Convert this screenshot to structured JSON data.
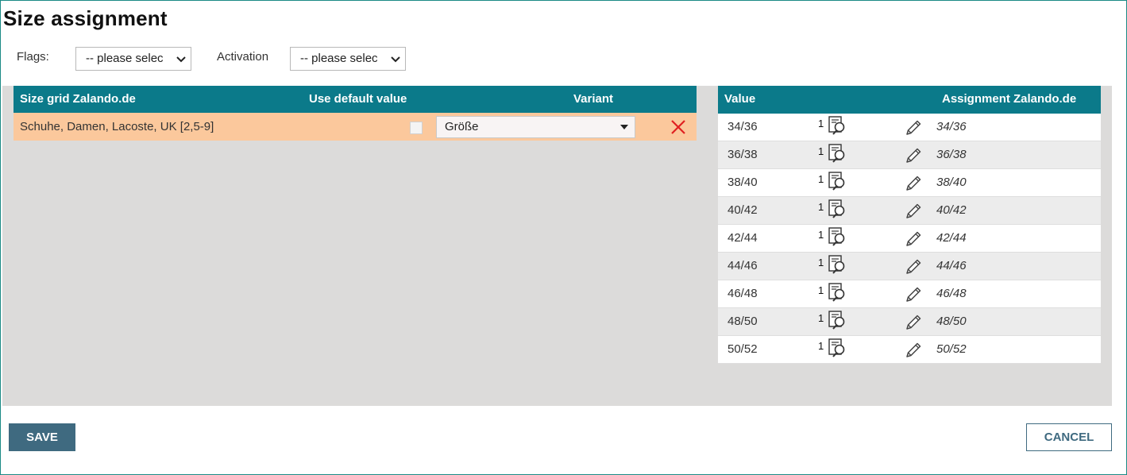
{
  "page": {
    "title": "Size assignment"
  },
  "filters": {
    "flags_label": "Flags:",
    "flags_value": "-- please selec",
    "activation_label": "Activation",
    "activation_value": "-- please selec"
  },
  "grid": {
    "headers": {
      "size_grid": "Size grid Zalando.de",
      "use_default": "Use default value",
      "variant": "Variant"
    },
    "row": {
      "name": "Schuhe, Damen, Lacoste, UK [2,5-9]",
      "use_default_checked": false,
      "variant": "Größe",
      "delete_icon": "close-icon"
    }
  },
  "values": {
    "headers": {
      "value": "Value",
      "assignment": "Assignment Zalando.de"
    },
    "rows": [
      {
        "value": "34/36",
        "count": "1",
        "assignment": "34/36"
      },
      {
        "value": "36/38",
        "count": "1",
        "assignment": "36/38"
      },
      {
        "value": "38/40",
        "count": "1",
        "assignment": "38/40"
      },
      {
        "value": "40/42",
        "count": "1",
        "assignment": "40/42"
      },
      {
        "value": "42/44",
        "count": "1",
        "assignment": "42/44"
      },
      {
        "value": "44/46",
        "count": "1",
        "assignment": "44/46"
      },
      {
        "value": "46/48",
        "count": "1",
        "assignment": "46/48"
      },
      {
        "value": "48/50",
        "count": "1",
        "assignment": "48/50"
      },
      {
        "value": "50/52",
        "count": "1",
        "assignment": "50/52"
      }
    ]
  },
  "actions": {
    "save": "SAVE",
    "cancel": "CANCEL"
  },
  "colors": {
    "header_teal": "#0b7a8a",
    "row_highlight": "#fbc89c",
    "panel_gray": "#dcdbda",
    "button_blue": "#3f6a80",
    "delete_red": "#e02020"
  }
}
